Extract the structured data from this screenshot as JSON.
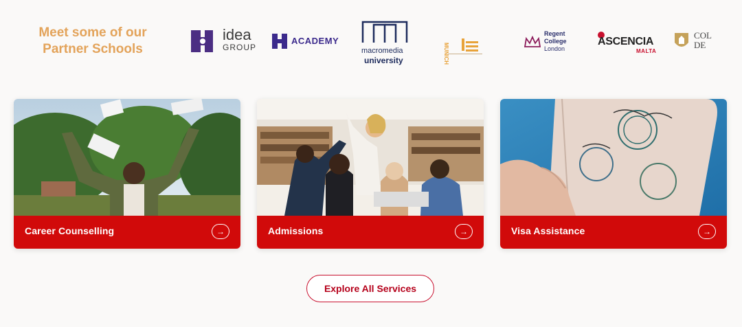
{
  "partners": {
    "title": "Meet some of our Partner Schools",
    "logos": [
      {
        "name": "idea GROUP",
        "line1": "idea",
        "line2": "GROUP"
      },
      {
        "name": "ACADEMY",
        "text": "ACADEMY"
      },
      {
        "name": "macromedia university",
        "line1": "macromedia",
        "line2": "university"
      },
      {
        "name": "MUNICH",
        "text": "MUNICH"
      },
      {
        "name": "Regent College London",
        "line1": "Regent",
        "line2": "College",
        "line3": "London"
      },
      {
        "name": "ASCENCIA MALTA",
        "line1": "ASCENCIA",
        "line2": "MALTA"
      },
      {
        "name": "COLLEGE DE",
        "line1": "COL",
        "line2": "DE"
      }
    ]
  },
  "services": [
    {
      "label": "Career Counselling",
      "image": "graduate-celebrating-photo"
    },
    {
      "label": "Admissions",
      "image": "students-high-five-photo"
    },
    {
      "label": "Visa Assistance",
      "image": "passport-visa-stamps-photo"
    }
  ],
  "explore_button": {
    "label": "Explore All Services"
  },
  "colors": {
    "accent_red": "#d10a0a",
    "title_orange": "#e3a35a",
    "academy_purple": "#3b2a8c"
  }
}
